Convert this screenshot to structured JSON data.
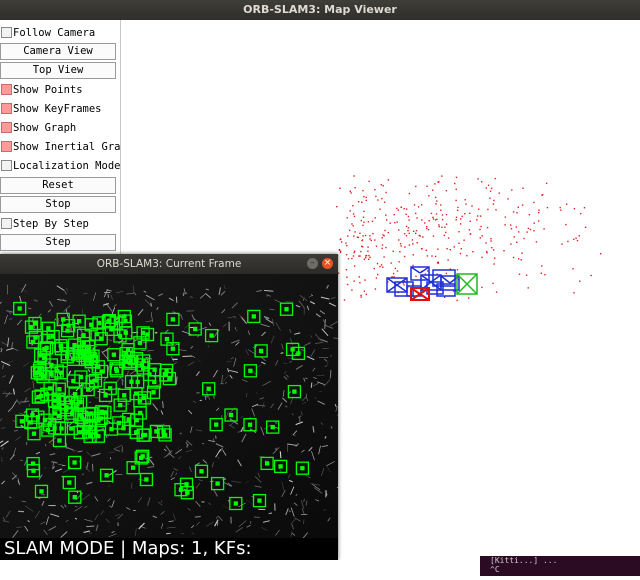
{
  "map_viewer": {
    "title": "ORB-SLAM3: Map Viewer",
    "panel": [
      {
        "type": "checkbox",
        "label": "Follow Camera",
        "checked": false
      },
      {
        "type": "button",
        "label": "Camera View"
      },
      {
        "type": "button",
        "label": "Top View"
      },
      {
        "type": "checkbox",
        "label": "Show Points",
        "checked": true
      },
      {
        "type": "checkbox",
        "label": "Show KeyFrames",
        "checked": true
      },
      {
        "type": "checkbox",
        "label": "Show Graph",
        "checked": true
      },
      {
        "type": "checkbox",
        "label": "Show Inertial Graph",
        "checked": true
      },
      {
        "type": "checkbox",
        "label": "Localization Mode",
        "checked": false
      },
      {
        "type": "button",
        "label": "Reset"
      },
      {
        "type": "button",
        "label": "Stop"
      },
      {
        "type": "checkbox",
        "label": "Step By Step",
        "checked": false
      },
      {
        "type": "button",
        "label": "Step"
      }
    ],
    "colors": {
      "points": "#e02020",
      "keyframes": "#1f2fd8",
      "current_camera": "#1fb81f",
      "reference": "#e01010"
    }
  },
  "current_frame": {
    "title": "ORB-SLAM3: Current Frame",
    "status_text": "SLAM MODE |  Maps: 1, KFs:",
    "feature_color": "#00ff00"
  },
  "terminal": {
    "lines": [
      "[Kitti...]  ...",
      "^C"
    ]
  }
}
